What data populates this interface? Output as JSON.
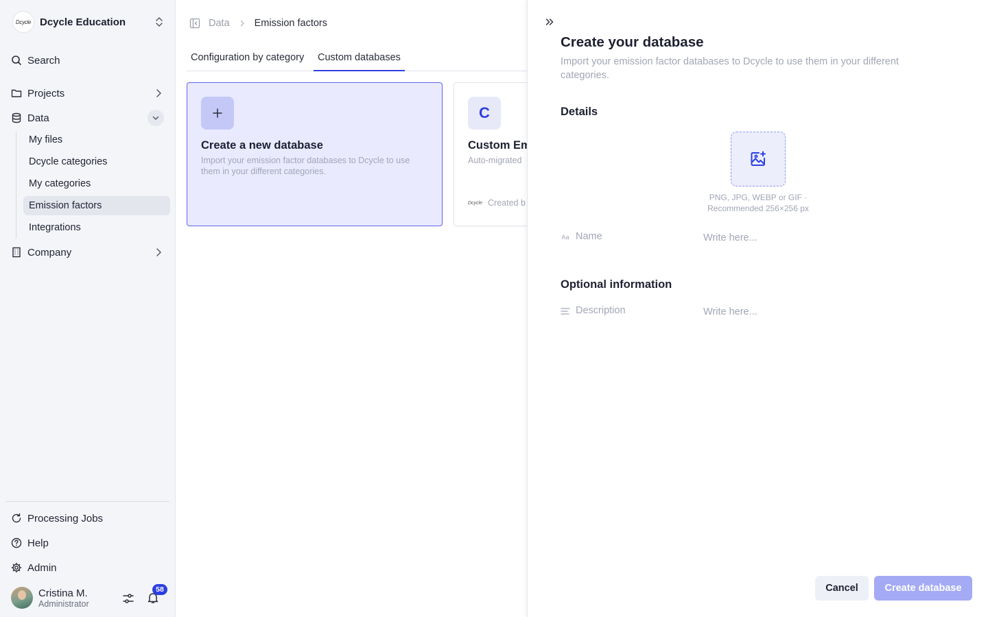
{
  "org": {
    "logo_text": "Dcycle",
    "name": "Dcycle Education"
  },
  "nav": {
    "search": "Search",
    "projects": "Projects",
    "data": "Data",
    "data_children": [
      "My files",
      "Dcycle categories",
      "My categories",
      "Emission factors",
      "Integrations"
    ],
    "company": "Company",
    "processing_jobs": "Processing Jobs",
    "help": "Help",
    "admin": "Admin"
  },
  "user": {
    "name": "Cristina M.",
    "role": "Administrator",
    "notifications": "58"
  },
  "breadcrumb": {
    "parent": "Data",
    "current": "Emission factors"
  },
  "tabs": [
    "Configuration by category",
    "Custom databases"
  ],
  "cards": {
    "new": {
      "title": "Create a new database",
      "description": "Import your emission factor databases to Dcycle to use them in your different categories."
    },
    "custom": {
      "letter": "C",
      "title": "Custom Em",
      "description": "Auto-migrated",
      "creator_logo": "Dcycle",
      "created_by": "Created b"
    }
  },
  "drawer": {
    "title": "Create your database",
    "subtitle": "Import your emission factor databases to Dcycle to use them in your different categories.",
    "details": "Details",
    "upload_hint": "PNG, JPG, WEBP or GIF · Recommended 256×256 px",
    "name_icon_text": "Aa",
    "name_label": "Name",
    "name_placeholder": "Write here...",
    "optional": "Optional information",
    "description_label": "Description",
    "description_placeholder": "Write here...",
    "cancel": "Cancel",
    "create": "Create database"
  },
  "colors": {
    "accent": "#2e3fe0",
    "card_bg": "#e9eafd",
    "create_btn": "#a4aaf3"
  }
}
